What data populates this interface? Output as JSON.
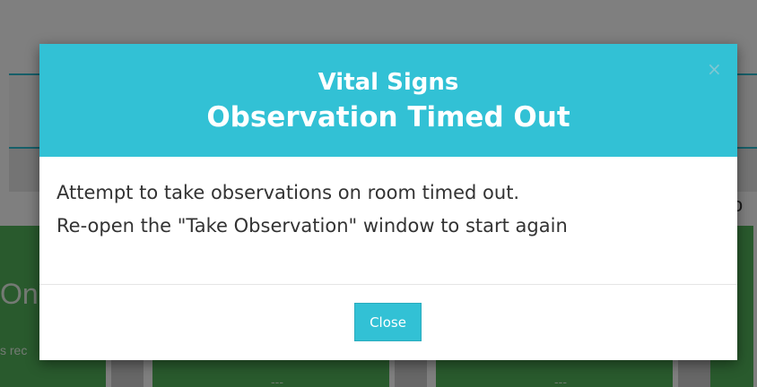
{
  "background": {
    "heading_right": "Ro",
    "tile_big_text": "On",
    "tile_small_text": "s rec",
    "tile_dash": "---"
  },
  "modal": {
    "subtitle": "Vital Signs",
    "title": "Observation Timed Out",
    "close_icon": "×",
    "message_line1": "Attempt to take observations on room timed out.",
    "message_line2": "Re-open the \"Take Observation\" window to start again",
    "close_button_label": "Close"
  },
  "colors": {
    "accent": "#32c1d5",
    "tile_green": "#53b55b",
    "text": "#333333"
  }
}
